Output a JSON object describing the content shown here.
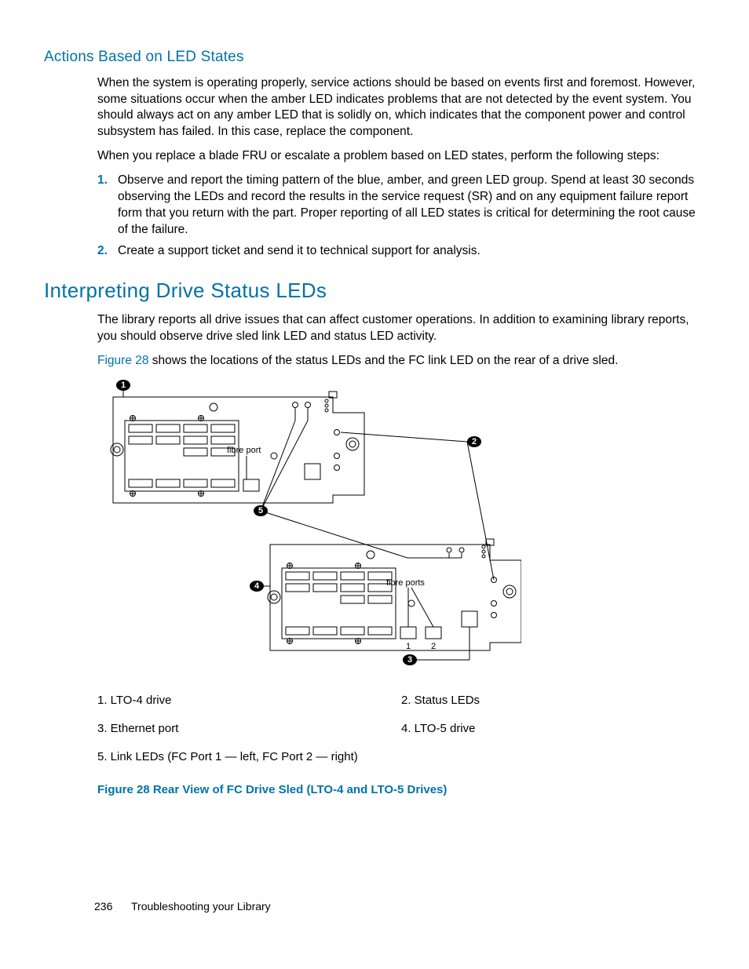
{
  "section1": {
    "title": "Actions Based on LED States",
    "para1": "When the system is operating properly, service actions should be based on events first and foremost. However, some situations occur when the amber LED indicates problems that are not detected by the event system. You should always act on any amber LED that is solidly on, which indicates that the component power and control subsystem has failed. In this case, replace the component.",
    "para2": "When you replace a blade FRU or escalate a problem based on LED states, perform the following steps:",
    "list": [
      {
        "num": "1.",
        "text": "Observe and report the timing pattern of the blue, amber, and green LED group. Spend at least 30 seconds observing the LEDs and record the results in the service request (SR) and on any equipment failure report form that you return with the part. Proper reporting of all LED states is critical for determining the root cause of the failure."
      },
      {
        "num": "2.",
        "text": "Create a support ticket and send it to technical support for analysis."
      }
    ]
  },
  "section2": {
    "title": "Interpreting Drive Status LEDs",
    "para1": "The library reports all drive issues that can affect customer operations. In addition to examining library reports, you should observe drive sled link LED and status LED activity.",
    "link_text": "Figure 28",
    "para2_rest": " shows the locations of the status LEDs and the FC link LED on the rear of a drive sled.",
    "diagram_labels": {
      "fibre_port": "fibre port",
      "fibre_ports": "fibre ports",
      "one": "1",
      "two": "2"
    },
    "callouts": {
      "c1": "1",
      "c2": "2",
      "c3": "3",
      "c4": "4",
      "c5": "5"
    },
    "legend": [
      "1. LTO-4 drive",
      "2. Status LEDs",
      "3. Ethernet port",
      "4. LTO-5 drive",
      "5. Link LEDs (FC Port 1 — left, FC Port 2 — right)"
    ],
    "figure_caption": "Figure 28 Rear View of FC Drive Sled (LTO-4 and LTO-5 Drives)"
  },
  "footer": {
    "page": "236",
    "title": "Troubleshooting your Library"
  }
}
